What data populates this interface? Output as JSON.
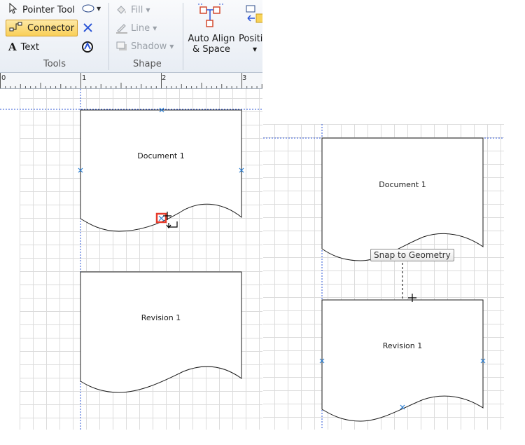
{
  "ribbon": {
    "tools_group": {
      "label": "Tools",
      "items": [
        "Pointer Tool",
        "Connector",
        "Text"
      ],
      "active": "Connector"
    },
    "shape_group": {
      "label": "Shape",
      "items": [
        "Fill",
        "Line",
        "Shadow"
      ]
    },
    "auto_align": {
      "line1": "Auto Align",
      "line2": "& Space"
    },
    "position_label": "Positi"
  },
  "ruler": {
    "marks": [
      "0",
      "1",
      "2",
      "3"
    ]
  },
  "left_view": {
    "shape1_label": "Document 1",
    "shape2_label": "Revision 1"
  },
  "right_view": {
    "shape1_label": "Document 1",
    "shape2_label": "Revision 1",
    "tooltip": "Snap to Geometry"
  },
  "colors": {
    "accent_guide": "#2b55d6",
    "connection_point": "#2a7fd4",
    "highlight": "#e53b2c",
    "active_tool": "#f9cf58"
  }
}
